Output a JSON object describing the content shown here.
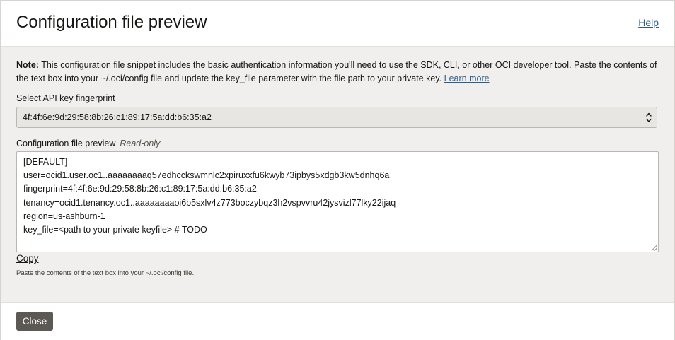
{
  "dialog": {
    "title": "Configuration file preview",
    "help_label": "Help"
  },
  "note": {
    "prefix": "Note:",
    "text": " This configuration file snippet includes the basic authentication information you'll need to use the SDK, CLI, or other OCI developer tool. Paste the contents of the text box into your ~/.oci/config file and update the key_file parameter with the file path to your private key. ",
    "learn_more": "Learn more"
  },
  "fingerprint_select": {
    "label": "Select API key fingerprint",
    "value": "4f:4f:6e:9d:29:58:8b:26:c1:89:17:5a:dd:b6:35:a2"
  },
  "preview": {
    "label": "Configuration file preview",
    "hint": "Read-only",
    "lines": [
      "[DEFAULT]",
      "user=ocid1.user.oc1..aaaaaaaaq57edhcckswmnlc2xpiruxxfu6kwyb73ipbys5xdgb3kw5dnhq6a",
      "fingerprint=4f:4f:6e:9d:29:58:8b:26:c1:89:17:5a:dd:b6:35:a2",
      "tenancy=ocid1.tenancy.oc1..aaaaaaaaoi6b5sxlv4z773boczybqz3h2vspvvru42jysvizl77lky22ijaq",
      "region=us-ashburn-1",
      "key_file=<path to your private keyfile> # TODO"
    ],
    "copy_label": "Copy",
    "helper": "Paste the contents of the text box into your ~/.oci/config file."
  },
  "footer": {
    "close_label": "Close"
  },
  "icons": {
    "select_arrows": "chevron-up-down-icon",
    "resize": "resize-grip-icon"
  },
  "colors": {
    "link": "#2b5f8a",
    "close_button": "#5c5854",
    "dialog_bg": "#f1efed"
  }
}
